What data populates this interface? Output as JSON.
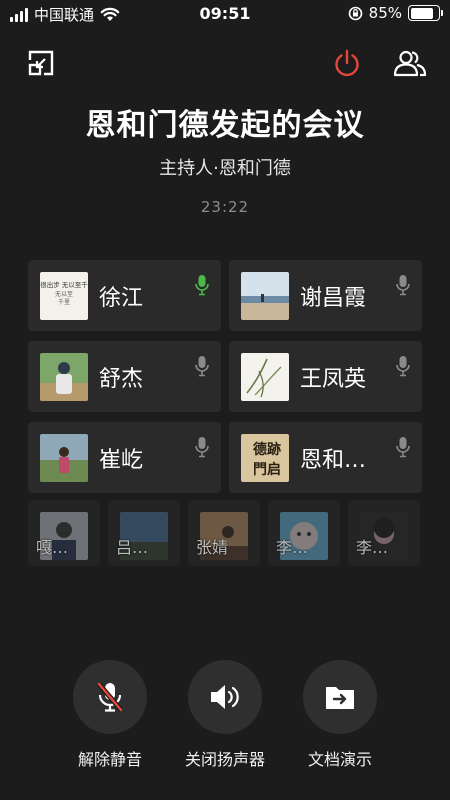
{
  "status_bar": {
    "carrier": "中国联通",
    "time": "09:51",
    "battery": "85%",
    "battery_level": 0.85
  },
  "meeting": {
    "title": "恩和门德发起的会议",
    "host_label": "主持人·恩和门德",
    "duration": "23:22"
  },
  "participants": [
    {
      "name": "徐江",
      "mic": "active",
      "avatar_text": "不很出步 无以至千里"
    },
    {
      "name": "谢昌霞",
      "mic": "idle"
    },
    {
      "name": "舒杰",
      "mic": "idle"
    },
    {
      "name": "王凤英",
      "mic": "idle"
    },
    {
      "name": "崔屹",
      "mic": "idle"
    },
    {
      "name": "恩和…",
      "mic": "idle",
      "avatar_text": "德 門 跡 启"
    }
  ],
  "waiting": [
    {
      "name": "嘎…"
    },
    {
      "name": "吕…"
    },
    {
      "name": "张婧"
    },
    {
      "name": "李…"
    },
    {
      "name": "李…"
    }
  ],
  "controls": [
    {
      "label": "解除静音",
      "icon": "mic-muted-icon"
    },
    {
      "label": "关闭扬声器",
      "icon": "speaker-icon"
    },
    {
      "label": "文档演示",
      "icon": "folder-share-icon"
    }
  ],
  "colors": {
    "background": "#1c1c1c",
    "card": "#2a2a2a",
    "power": "#e5483b",
    "mic_active": "#4cb84c",
    "mute_slash": "#e5483b"
  }
}
